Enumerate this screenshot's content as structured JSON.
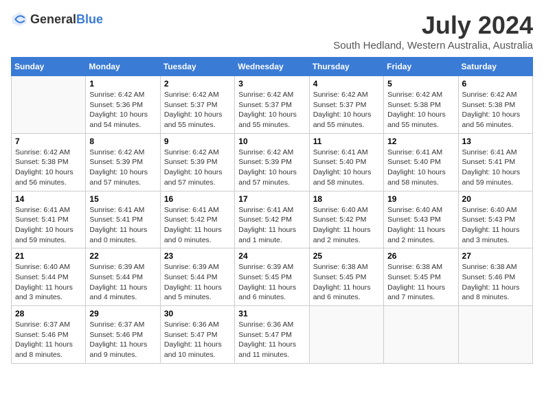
{
  "logo": {
    "general": "General",
    "blue": "Blue"
  },
  "title": "July 2024",
  "subtitle": "South Hedland, Western Australia, Australia",
  "days": [
    "Sunday",
    "Monday",
    "Tuesday",
    "Wednesday",
    "Thursday",
    "Friday",
    "Saturday"
  ],
  "weeks": [
    [
      {
        "date": "",
        "info": ""
      },
      {
        "date": "1",
        "info": "Sunrise: 6:42 AM\nSunset: 5:36 PM\nDaylight: 10 hours\nand 54 minutes."
      },
      {
        "date": "2",
        "info": "Sunrise: 6:42 AM\nSunset: 5:37 PM\nDaylight: 10 hours\nand 55 minutes."
      },
      {
        "date": "3",
        "info": "Sunrise: 6:42 AM\nSunset: 5:37 PM\nDaylight: 10 hours\nand 55 minutes."
      },
      {
        "date": "4",
        "info": "Sunrise: 6:42 AM\nSunset: 5:37 PM\nDaylight: 10 hours\nand 55 minutes."
      },
      {
        "date": "5",
        "info": "Sunrise: 6:42 AM\nSunset: 5:38 PM\nDaylight: 10 hours\nand 55 minutes."
      },
      {
        "date": "6",
        "info": "Sunrise: 6:42 AM\nSunset: 5:38 PM\nDaylight: 10 hours\nand 56 minutes."
      }
    ],
    [
      {
        "date": "7",
        "info": "Sunrise: 6:42 AM\nSunset: 5:38 PM\nDaylight: 10 hours\nand 56 minutes."
      },
      {
        "date": "8",
        "info": "Sunrise: 6:42 AM\nSunset: 5:39 PM\nDaylight: 10 hours\nand 57 minutes."
      },
      {
        "date": "9",
        "info": "Sunrise: 6:42 AM\nSunset: 5:39 PM\nDaylight: 10 hours\nand 57 minutes."
      },
      {
        "date": "10",
        "info": "Sunrise: 6:42 AM\nSunset: 5:39 PM\nDaylight: 10 hours\nand 57 minutes."
      },
      {
        "date": "11",
        "info": "Sunrise: 6:41 AM\nSunset: 5:40 PM\nDaylight: 10 hours\nand 58 minutes."
      },
      {
        "date": "12",
        "info": "Sunrise: 6:41 AM\nSunset: 5:40 PM\nDaylight: 10 hours\nand 58 minutes."
      },
      {
        "date": "13",
        "info": "Sunrise: 6:41 AM\nSunset: 5:41 PM\nDaylight: 10 hours\nand 59 minutes."
      }
    ],
    [
      {
        "date": "14",
        "info": "Sunrise: 6:41 AM\nSunset: 5:41 PM\nDaylight: 10 hours\nand 59 minutes."
      },
      {
        "date": "15",
        "info": "Sunrise: 6:41 AM\nSunset: 5:41 PM\nDaylight: 11 hours\nand 0 minutes."
      },
      {
        "date": "16",
        "info": "Sunrise: 6:41 AM\nSunset: 5:42 PM\nDaylight: 11 hours\nand 0 minutes."
      },
      {
        "date": "17",
        "info": "Sunrise: 6:41 AM\nSunset: 5:42 PM\nDaylight: 11 hours\nand 1 minute."
      },
      {
        "date": "18",
        "info": "Sunrise: 6:40 AM\nSunset: 5:42 PM\nDaylight: 11 hours\nand 2 minutes."
      },
      {
        "date": "19",
        "info": "Sunrise: 6:40 AM\nSunset: 5:43 PM\nDaylight: 11 hours\nand 2 minutes."
      },
      {
        "date": "20",
        "info": "Sunrise: 6:40 AM\nSunset: 5:43 PM\nDaylight: 11 hours\nand 3 minutes."
      }
    ],
    [
      {
        "date": "21",
        "info": "Sunrise: 6:40 AM\nSunset: 5:44 PM\nDaylight: 11 hours\nand 3 minutes."
      },
      {
        "date": "22",
        "info": "Sunrise: 6:39 AM\nSunset: 5:44 PM\nDaylight: 11 hours\nand 4 minutes."
      },
      {
        "date": "23",
        "info": "Sunrise: 6:39 AM\nSunset: 5:44 PM\nDaylight: 11 hours\nand 5 minutes."
      },
      {
        "date": "24",
        "info": "Sunrise: 6:39 AM\nSunset: 5:45 PM\nDaylight: 11 hours\nand 6 minutes."
      },
      {
        "date": "25",
        "info": "Sunrise: 6:38 AM\nSunset: 5:45 PM\nDaylight: 11 hours\nand 6 minutes."
      },
      {
        "date": "26",
        "info": "Sunrise: 6:38 AM\nSunset: 5:45 PM\nDaylight: 11 hours\nand 7 minutes."
      },
      {
        "date": "27",
        "info": "Sunrise: 6:38 AM\nSunset: 5:46 PM\nDaylight: 11 hours\nand 8 minutes."
      }
    ],
    [
      {
        "date": "28",
        "info": "Sunrise: 6:37 AM\nSunset: 5:46 PM\nDaylight: 11 hours\nand 8 minutes."
      },
      {
        "date": "29",
        "info": "Sunrise: 6:37 AM\nSunset: 5:46 PM\nDaylight: 11 hours\nand 9 minutes."
      },
      {
        "date": "30",
        "info": "Sunrise: 6:36 AM\nSunset: 5:47 PM\nDaylight: 11 hours\nand 10 minutes."
      },
      {
        "date": "31",
        "info": "Sunrise: 6:36 AM\nSunset: 5:47 PM\nDaylight: 11 hours\nand 11 minutes."
      },
      {
        "date": "",
        "info": ""
      },
      {
        "date": "",
        "info": ""
      },
      {
        "date": "",
        "info": ""
      }
    ]
  ]
}
